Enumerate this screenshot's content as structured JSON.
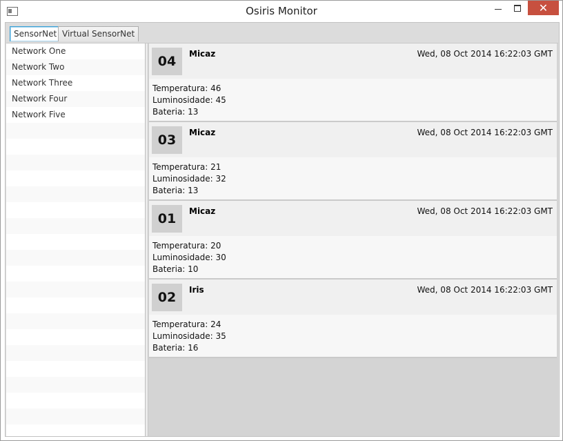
{
  "window": {
    "title": "Osiris Monitor",
    "close_glyph": "✕"
  },
  "tabs": [
    {
      "label": "SensorNet",
      "active": true
    },
    {
      "label": "Virtual SensorNet",
      "active": false
    }
  ],
  "networks": [
    {
      "label": "Network One"
    },
    {
      "label": "Network Two"
    },
    {
      "label": "Network Three"
    },
    {
      "label": "Network Four"
    },
    {
      "label": "Network Five"
    }
  ],
  "sensor_labels": {
    "temperature": "Temperatura:",
    "luminosity": "Luminosidade:",
    "battery": "Bateria:"
  },
  "sensors": [
    {
      "id": "04",
      "model": "Micaz",
      "timestamp": "Wed, 08 Oct 2014 16:22:03 GMT",
      "temperature": "46",
      "luminosity": "45",
      "battery": "13"
    },
    {
      "id": "03",
      "model": "Micaz",
      "timestamp": "Wed, 08 Oct 2014 16:22:03 GMT",
      "temperature": "21",
      "luminosity": "32",
      "battery": "13"
    },
    {
      "id": "01",
      "model": "Micaz",
      "timestamp": "Wed, 08 Oct 2014 16:22:03 GMT",
      "temperature": "20",
      "luminosity": "30",
      "battery": "10"
    },
    {
      "id": "02",
      "model": "Iris",
      "timestamp": "Wed, 08 Oct 2014 16:22:03 GMT",
      "temperature": "24",
      "luminosity": "35",
      "battery": "16"
    }
  ],
  "colors": {
    "close_button": "#c7503f",
    "active_tab_border": "#39a0d6",
    "card_id_bg": "#d0d0d0"
  }
}
